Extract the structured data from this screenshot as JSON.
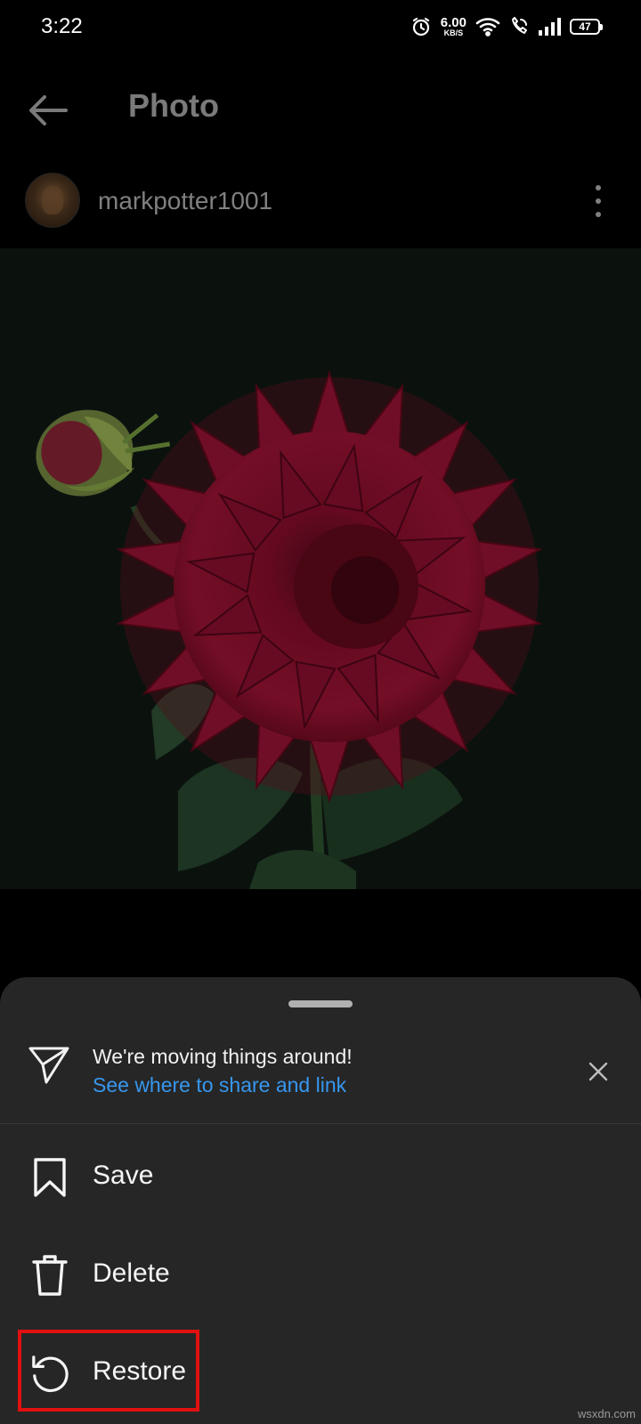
{
  "status_bar": {
    "time": "3:22",
    "net_speed_value": "6.00",
    "net_speed_unit": "KB/S",
    "battery": "47",
    "icons": [
      "alarm-icon",
      "wifi-icon",
      "wifi-calling-icon",
      "signal-icon",
      "battery-icon"
    ]
  },
  "app_bar": {
    "title": "Photo",
    "back_icon": "back-arrow-icon"
  },
  "post": {
    "username": "markpotter1001",
    "photo_subject": "flower-photo"
  },
  "sheet": {
    "notice_title": "We're moving things around!",
    "notice_link": "See where to share and link",
    "items": [
      {
        "label": "Save",
        "icon": "bookmark-icon"
      },
      {
        "label": "Delete",
        "icon": "trash-icon"
      },
      {
        "label": "Restore",
        "icon": "restore-icon"
      }
    ]
  },
  "watermark": "wsxdn.com",
  "colors": {
    "link": "#3797ef",
    "sheet_bg": "#262626",
    "highlight": "#e01010"
  }
}
